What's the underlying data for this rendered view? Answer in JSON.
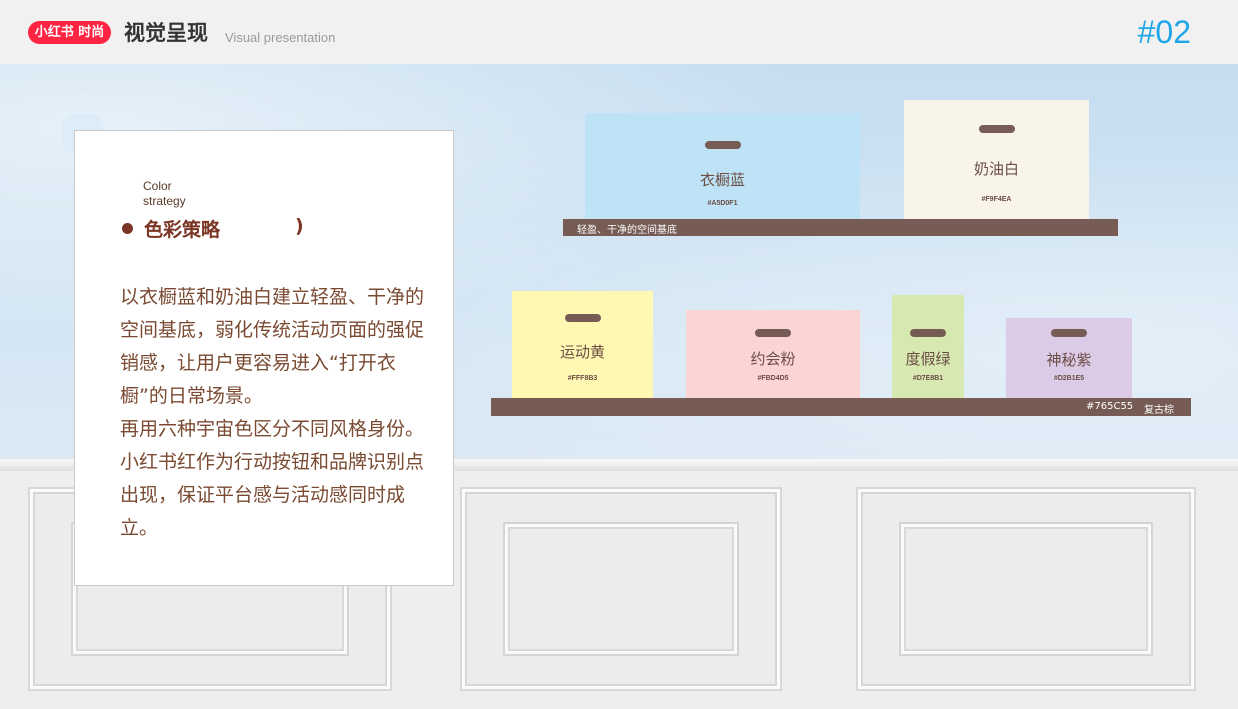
{
  "header": {
    "logo": "小红书 时尚",
    "title": "视觉呈现",
    "subtitle": "Visual presentation",
    "page_number": "#02"
  },
  "card": {
    "eyebrow_line1": "Color",
    "eyebrow_line2": "strategy",
    "title": "色彩策略",
    "title_paren": ")",
    "paragraph1": "以衣橱蓝和奶油白建立轻盈、干净的空间基底，弱化传统活动页面的强促销感，让用户更容易进入“打开衣橱”的日常场景。",
    "paragraph2": "再用六种宇宙色区分不同风格身份。小红书红作为行动按钮和品牌识别点出现，保证平台感与活动感同时成立。"
  },
  "shelves": {
    "top_label": "轻盈、干净的空间基底",
    "bottom_hex": "#765C55",
    "bottom_label": "复古棕",
    "shelf_color": "#765C55"
  },
  "boxes": [
    {
      "name": "衣橱蓝",
      "hex": "#A5D0F1",
      "color": "#bfe3f6"
    },
    {
      "name": "奶油白",
      "hex": "#F9F4EA",
      "color": "#f9f4ea"
    },
    {
      "name": "运动黄",
      "hex": "#FFF8B3",
      "color": "#fff8b3"
    },
    {
      "name": "约会粉",
      "hex": "#FBD4D5",
      "color": "#fbd4d5"
    },
    {
      "name": "度假绿",
      "hex": "#D7E8B1",
      "color": "#d7e8b1"
    },
    {
      "name": "神秘紫",
      "hex": "#D2B1E5",
      "color": "#dccbe6"
    }
  ]
}
